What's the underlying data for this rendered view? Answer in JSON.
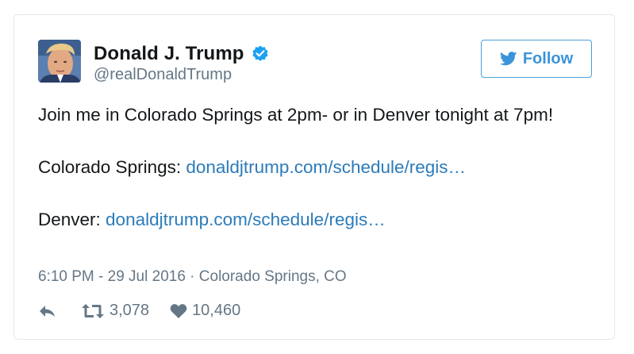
{
  "user": {
    "name": "Donald J. Trump",
    "handle": "@realDonaldTrump",
    "verified_icon": "verified-badge-icon",
    "avatar_icon": "avatar"
  },
  "follow_button": {
    "label": "Follow",
    "icon": "twitter-bird-icon"
  },
  "tweet": {
    "line1": "Join me in Colorado Springs at 2pm- or in Denver tonight at 7pm!",
    "line2_prefix": "Colorado Springs: ",
    "line2_link": "donaldjtrump.com/schedule/regis…",
    "line3_prefix": "Denver: ",
    "line3_link": "donaldjtrump.com/schedule/regis…"
  },
  "meta": {
    "timestamp": "6:10 PM - 29 Jul 2016",
    "separator": " · ",
    "location": "Colorado Springs, CO"
  },
  "actions": {
    "retweets": "3,078",
    "likes": "10,460"
  },
  "colors": {
    "accent": "#1da1f2",
    "link": "#2b7bb9",
    "muted": "#657786",
    "text": "#14171a",
    "border": "#e1e8ed"
  }
}
